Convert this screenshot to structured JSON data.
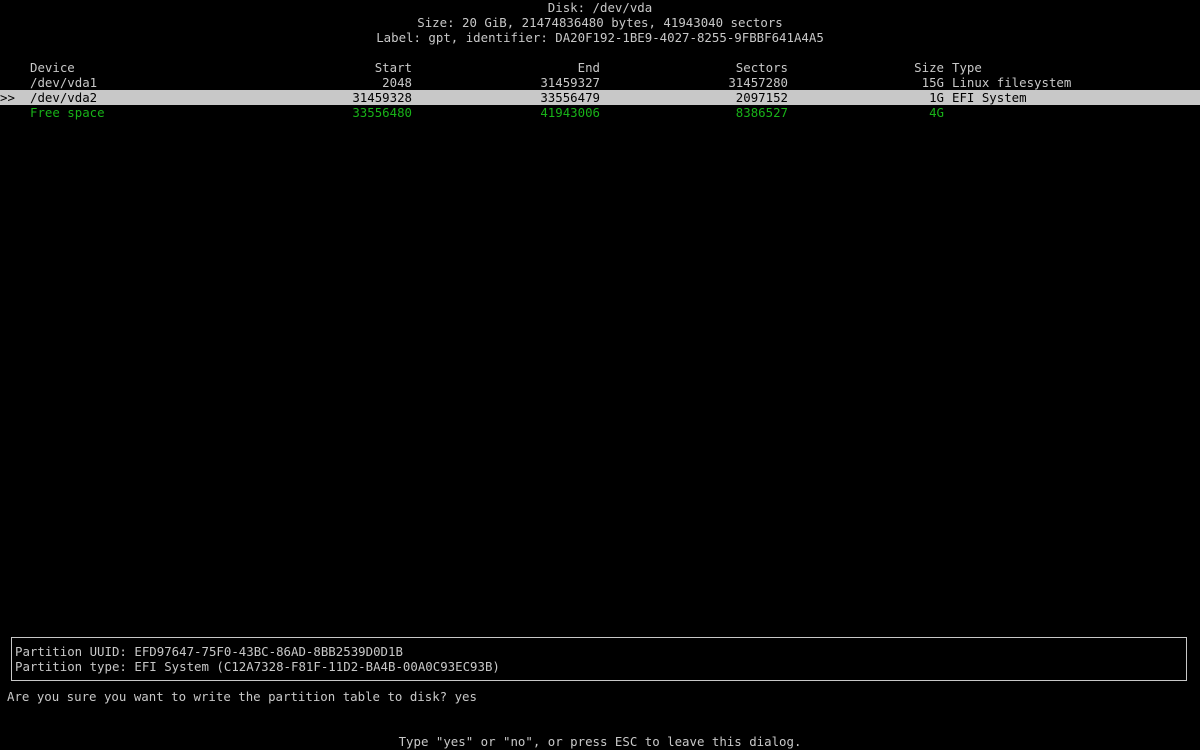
{
  "header": {
    "disk": "Disk: /dev/vda",
    "size": "Size: 20 GiB, 21474836480 bytes, 41943040 sectors",
    "label": "Label: gpt, identifier: DA20F192-1BE9-4027-8255-9FBBF641A4A5"
  },
  "table": {
    "columns": {
      "device": "Device",
      "start": "Start",
      "end": "End",
      "sectors": "Sectors",
      "size": "Size",
      "type": "Type"
    },
    "rows": [
      {
        "selector": "",
        "device": "/dev/vda1",
        "start": "2048",
        "end": "31459327",
        "sectors": "31457280",
        "size": "15G",
        "type": "Linux filesystem"
      },
      {
        "selector": ">>",
        "device": "/dev/vda2",
        "start": "31459328",
        "end": "33556479",
        "sectors": "2097152",
        "size": "1G",
        "type": "EFI System"
      },
      {
        "selector": "",
        "device": "Free space",
        "start": "33556480",
        "end": "41943006",
        "sectors": "8386527",
        "size": "4G",
        "type": ""
      }
    ]
  },
  "info": {
    "uuid": "Partition UUID: EFD97647-75F0-43BC-86AD-8BB2539D0D1B",
    "type": "Partition type: EFI System (C12A7328-F81F-11D2-BA4B-00A0C93EC93B)"
  },
  "prompt": {
    "question": "Are you sure you want to write the partition table to disk? ",
    "input_value": "yes"
  },
  "hint": "Type \"yes\" or \"no\", or press ESC to leave this dialog.",
  "colors": {
    "foreground": "#c8c8c8",
    "background": "#000000",
    "free_space": "#18b218",
    "selection_bg": "#c8c8c8",
    "selection_fg": "#000000"
  }
}
